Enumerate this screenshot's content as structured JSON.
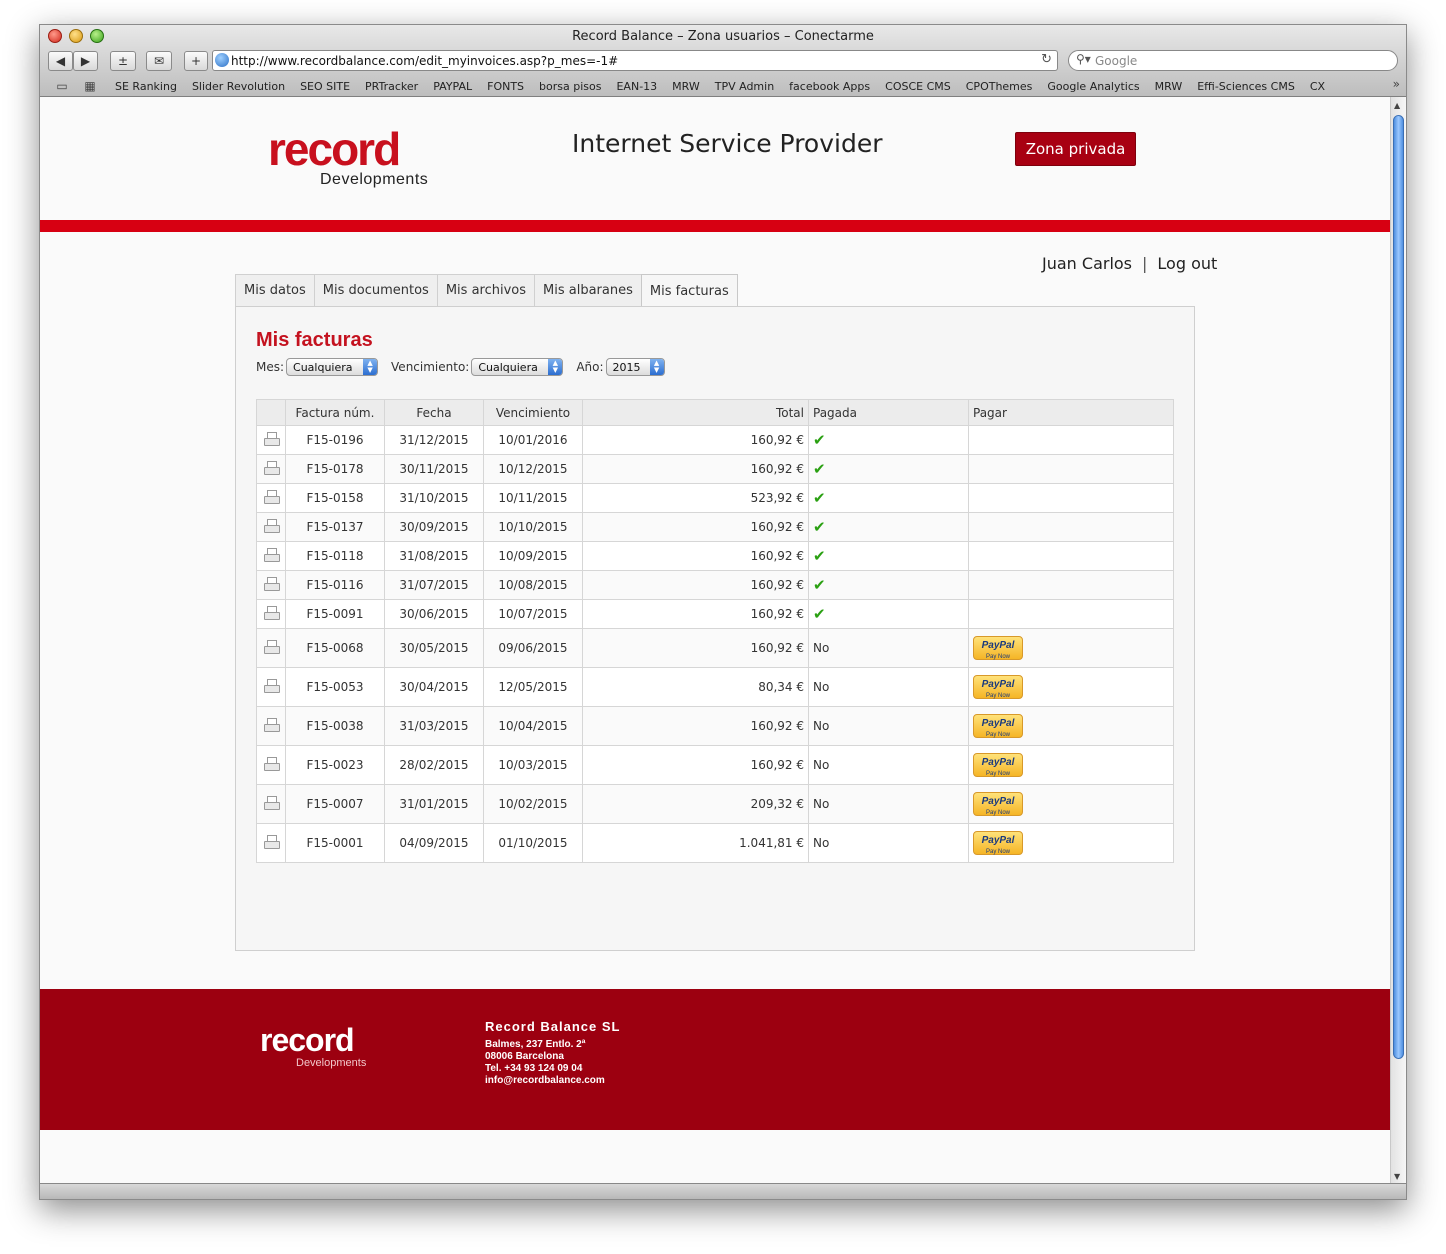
{
  "browser": {
    "window_title": "Record Balance – Zona usuarios – Conectarme",
    "url": "http://www.recordbalance.com/edit_myinvoices.asp?p_mes=-1#",
    "search_placeholder": "Google",
    "bookmarks": [
      "SE Ranking",
      "Slider Revolution",
      "SEO SITE",
      "PRTracker",
      "PAYPAL",
      "FONTS",
      "borsa pisos",
      "EAN-13",
      "MRW",
      "TPV Admin",
      "facebook Apps",
      "COSCE CMS",
      "CPOThemes",
      "Google Analytics",
      "MRW",
      "Effi-Sciences CMS",
      "CX"
    ]
  },
  "header": {
    "logo_text": "record",
    "logo_sub": "Developments",
    "tagline": "Internet Service Provider",
    "zona_button": "Zona privada"
  },
  "user": {
    "name": "Juan Carlos",
    "separator": "|",
    "logout": "Log out"
  },
  "tabs": [
    {
      "label": "Mis datos"
    },
    {
      "label": "Mis documentos"
    },
    {
      "label": "Mis archivos"
    },
    {
      "label": "Mis albaranes"
    },
    {
      "label": "Mis facturas",
      "active": true
    }
  ],
  "panel": {
    "title": "Mis facturas",
    "filters": {
      "mes_label": "Mes:",
      "mes_value": "Cualquiera",
      "venc_label": "Vencimiento:",
      "venc_value": "Cualquiera",
      "ano_label": "Año:",
      "ano_value": "2015"
    }
  },
  "table": {
    "headers": [
      "Factura núm.",
      "Fecha",
      "Vencimiento",
      "Total",
      "Pagada",
      "Pagar"
    ],
    "rows": [
      {
        "num": "F15-0196",
        "fecha": "31/12/2015",
        "venc": "10/01/2016",
        "total": "160,92 €",
        "paid": true
      },
      {
        "num": "F15-0178",
        "fecha": "30/11/2015",
        "venc": "10/12/2015",
        "total": "160,92 €",
        "paid": true
      },
      {
        "num": "F15-0158",
        "fecha": "31/10/2015",
        "venc": "10/11/2015",
        "total": "523,92 €",
        "paid": true
      },
      {
        "num": "F15-0137",
        "fecha": "30/09/2015",
        "venc": "10/10/2015",
        "total": "160,92 €",
        "paid": true
      },
      {
        "num": "F15-0118",
        "fecha": "31/08/2015",
        "venc": "10/09/2015",
        "total": "160,92 €",
        "paid": true
      },
      {
        "num": "F15-0116",
        "fecha": "31/07/2015",
        "venc": "10/08/2015",
        "total": "160,92 €",
        "paid": true
      },
      {
        "num": "F15-0091",
        "fecha": "30/06/2015",
        "venc": "10/07/2015",
        "total": "160,92 €",
        "paid": true
      },
      {
        "num": "F15-0068",
        "fecha": "30/05/2015",
        "venc": "09/06/2015",
        "total": "160,92 €",
        "paid": false,
        "paid_text": "No"
      },
      {
        "num": "F15-0053",
        "fecha": "30/04/2015",
        "venc": "12/05/2015",
        "total": "80,34 €",
        "paid": false,
        "paid_text": "No"
      },
      {
        "num": "F15-0038",
        "fecha": "31/03/2015",
        "venc": "10/04/2015",
        "total": "160,92 €",
        "paid": false,
        "paid_text": "No"
      },
      {
        "num": "F15-0023",
        "fecha": "28/02/2015",
        "venc": "10/03/2015",
        "total": "160,92 €",
        "paid": false,
        "paid_text": "No"
      },
      {
        "num": "F15-0007",
        "fecha": "31/01/2015",
        "venc": "10/02/2015",
        "total": "209,32 €",
        "paid": false,
        "paid_text": "No"
      },
      {
        "num": "F15-0001",
        "fecha": "04/09/2015",
        "venc": "01/10/2015",
        "total": "1.041,81 €",
        "paid": false,
        "paid_text": "No"
      }
    ],
    "paypal_label": "PayPal",
    "paypal_sub": "Pay Now"
  },
  "footer": {
    "logo_text": "record",
    "logo_sub": "Developments",
    "company": "Record Balance SL",
    "address1": "Balmes, 237 Entlo. 2ª",
    "address2": "08006 Barcelona",
    "phone": "Tel. +34 93 124 09 04",
    "email": "info@recordbalance.com"
  },
  "colors": {
    "brand_red": "#d70012",
    "footer_red": "#9c0010",
    "title_red": "#c4121f",
    "check_green": "#2aa012"
  }
}
